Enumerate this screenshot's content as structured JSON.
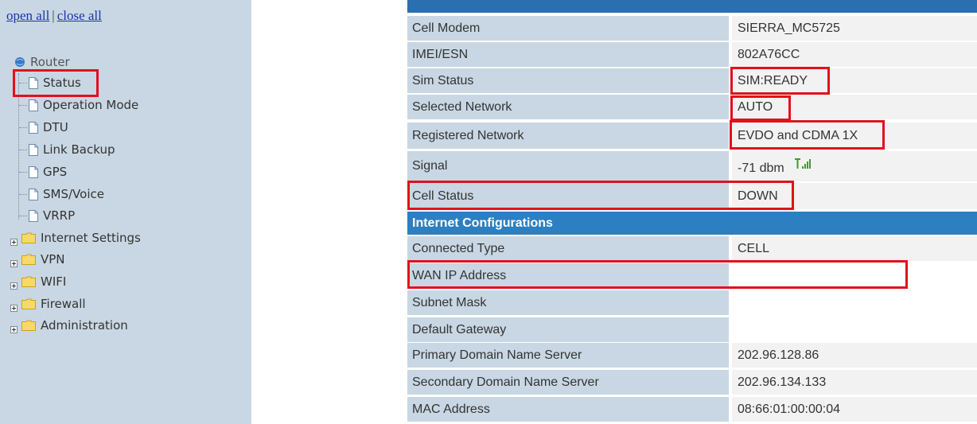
{
  "sidebar": {
    "open_all": "open all",
    "separator": "|",
    "close_all": "close all",
    "root": {
      "label": "Router",
      "icon": "globe-icon"
    },
    "pages": [
      {
        "label": "Status",
        "icon": "page-icon"
      },
      {
        "label": "Operation Mode",
        "icon": "page-icon"
      },
      {
        "label": "DTU",
        "icon": "page-icon"
      },
      {
        "label": "Link Backup",
        "icon": "page-icon"
      },
      {
        "label": "GPS",
        "icon": "page-icon"
      },
      {
        "label": "SMS/Voice",
        "icon": "page-icon"
      },
      {
        "label": "VRRP",
        "icon": "page-icon"
      }
    ],
    "folders": [
      {
        "label": "Internet Settings",
        "icon": "folder-icon"
      },
      {
        "label": "VPN",
        "icon": "folder-icon"
      },
      {
        "label": "WIFI",
        "icon": "folder-icon"
      },
      {
        "label": "Firewall",
        "icon": "folder-icon"
      },
      {
        "label": "Administration",
        "icon": "folder-icon"
      }
    ]
  },
  "cell": {
    "rows": [
      {
        "label": "Cell Modem",
        "value": "SIERRA_MC5725"
      },
      {
        "label": "IMEI/ESN",
        "value": "802A76CC"
      },
      {
        "label": "Sim Status",
        "value": "SIM:READY"
      },
      {
        "label": "Selected Network",
        "value": "AUTO"
      },
      {
        "label": "Registered Network",
        "value": "EVDO and CDMA 1X"
      },
      {
        "label": "Signal",
        "value": "-71 dbm",
        "icon": "signal-strength-icon"
      },
      {
        "label": "Cell Status",
        "value": "DOWN"
      }
    ]
  },
  "internet": {
    "title": "Internet Configurations",
    "rows": [
      {
        "label": "Connected Type",
        "value": "CELL"
      },
      {
        "label": "WAN IP Address",
        "value": ""
      },
      {
        "label": "Subnet Mask",
        "value": ""
      },
      {
        "label": "Default Gateway",
        "value": ""
      },
      {
        "label": "Primary Domain Name Server",
        "value": "202.96.128.86"
      },
      {
        "label": "Secondary Domain Name Server",
        "value": "202.96.134.133"
      },
      {
        "label": "MAC Address",
        "value": "08:66:01:00:00:04"
      }
    ]
  },
  "colors": {
    "sidebar_bg": "#c8d7e3",
    "header_blue": "#2c7fc1",
    "highlight_red": "#e0121b",
    "link_blue": "#1a33a8"
  }
}
